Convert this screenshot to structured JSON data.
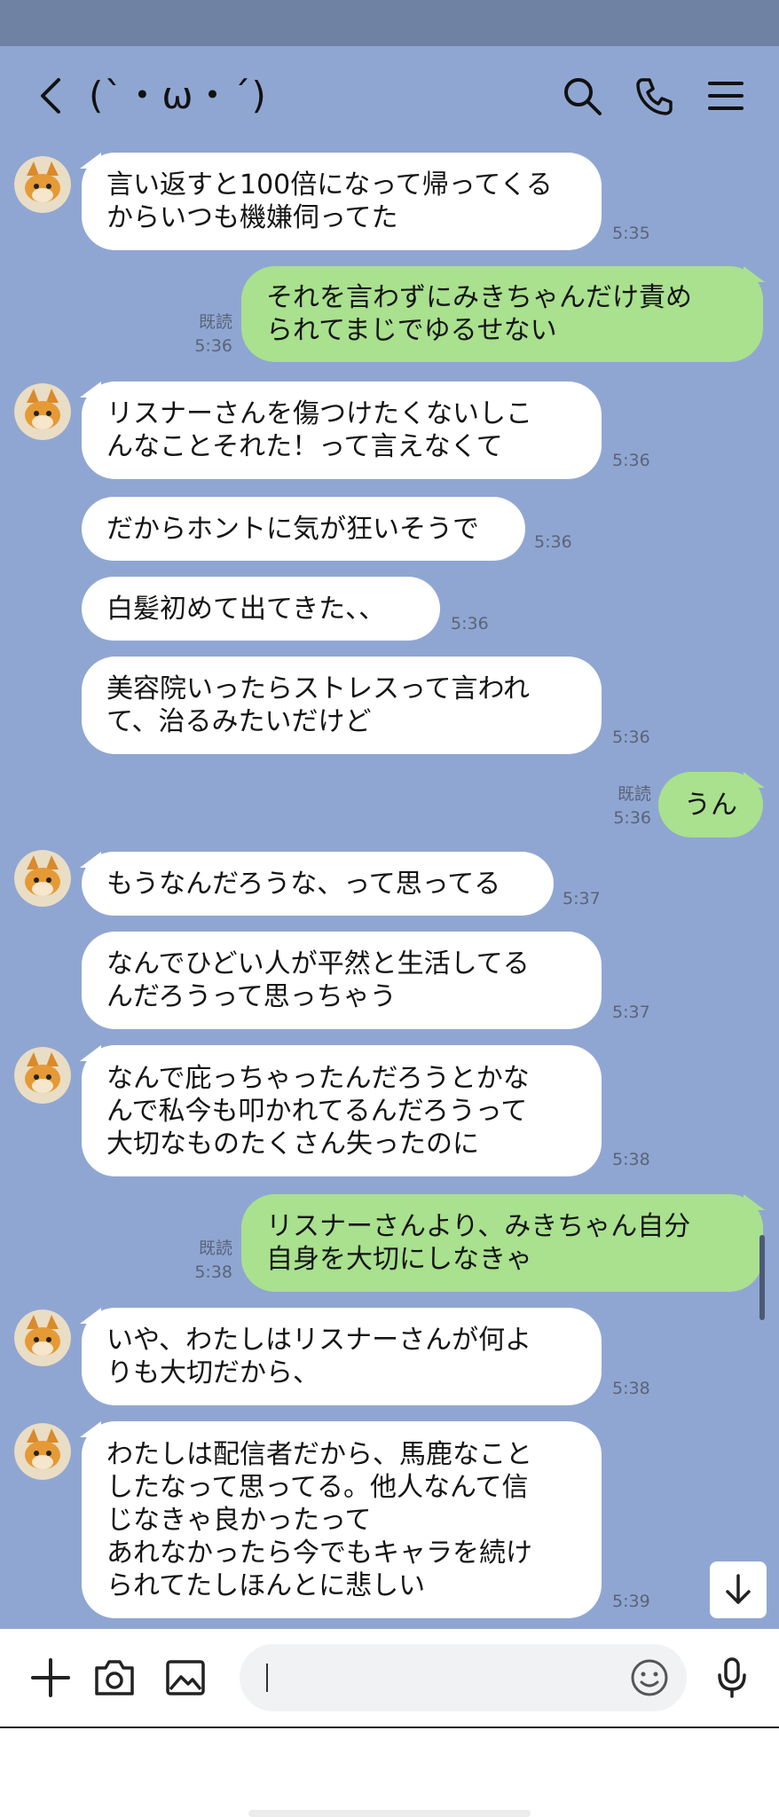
{
  "header": {
    "title": "(`・ω・´)",
    "icons": [
      "back-icon",
      "search-icon",
      "phone-icon",
      "menu-icon"
    ]
  },
  "colors": {
    "chat_bg": "#90a6d2",
    "incoming_bubble": "#ffffff",
    "outgoing_bubble": "#a9e18e",
    "status_bar": "#6f82a3"
  },
  "messages": [
    {
      "dir": "in",
      "text": "言い返すと100倍になって帰ってくる\nからいつも機嫌伺ってた",
      "time": "5:35"
    },
    {
      "dir": "out",
      "text": "それを言わずにみきちゃんだけ責め\nられてまじでゆるせない",
      "read": "既読",
      "time": "5:36"
    },
    {
      "dir": "in",
      "text": "リスナーさんを傷つけたくないしこ\nんなことそれた！って言えなくて",
      "time": "5:36"
    },
    {
      "dir": "in",
      "text": "だからホントに気が狂いそうで",
      "time": "5:36"
    },
    {
      "dir": "in",
      "text": "白髪初めて出てきた、、",
      "time": "5:36"
    },
    {
      "dir": "in",
      "text": "美容院いったらストレスって言われ\nて、治るみたいだけど",
      "time": "5:36"
    },
    {
      "dir": "out",
      "text": "うん",
      "read": "既読",
      "time": "5:36"
    },
    {
      "dir": "in",
      "text": "もうなんだろうな、って思ってる",
      "time": "5:37"
    },
    {
      "dir": "in",
      "text": "なんでひどい人が平然と生活してる\nんだろうって思っちゃう",
      "time": "5:37"
    },
    {
      "dir": "in",
      "text": "なんで庇っちゃったんだろうとかな\nんで私今も叩かれてるんだろうって\n大切なものたくさん失ったのに",
      "time": "5:38"
    },
    {
      "dir": "out",
      "text": "リスナーさんより、みきちゃん自分\n自身を大切にしなきゃ",
      "read": "既読",
      "time": "5:38"
    },
    {
      "dir": "in",
      "text": "いや、わたしはリスナーさんが何よ\nりも大切だから、",
      "time": "5:38"
    },
    {
      "dir": "in",
      "text": "わたしは配信者だから、馬鹿なこと\nしたなって思ってる。他人なんて信\nじなきゃ良かったって\nあれなかったら今でもキャラを続け\nられてたしほんとに悲しい",
      "time": "5:39"
    }
  ],
  "input_bar": {
    "placeholder": "",
    "icons": [
      "plus-icon",
      "camera-icon",
      "image-icon",
      "emoji-icon",
      "microphone-icon"
    ]
  }
}
